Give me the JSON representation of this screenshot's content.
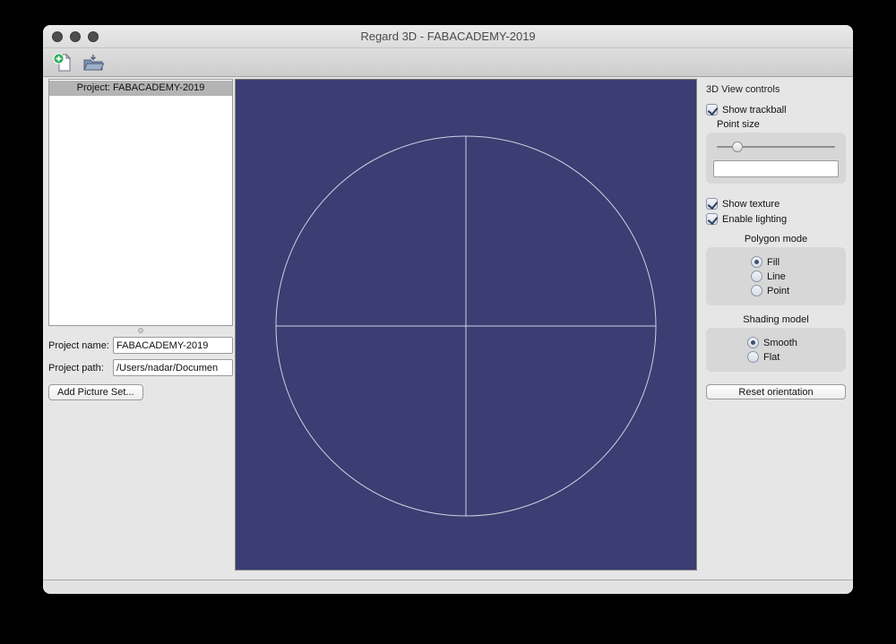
{
  "window": {
    "title": "Regard 3D - FABACADEMY-2019"
  },
  "toolbar": {
    "new_project_icon": "new-project",
    "open_project_icon": "open-project"
  },
  "left_panel": {
    "tree_selected": "Project: FABACADEMY-2019",
    "form": {
      "name_label": "Project name:",
      "name_value": "FABACADEMY-2019",
      "path_label": "Project path:",
      "path_value": "/Users/nadar/Documen",
      "add_button": "Add Picture Set..."
    }
  },
  "viewport": {
    "background": "#3b3d73",
    "trackball_color": "#e9e9f2"
  },
  "right_panel": {
    "title": "3D View controls",
    "checkboxes": [
      {
        "label": "Show trackball",
        "checked": true
      },
      {
        "label": "Show texture",
        "checked": true
      },
      {
        "label": "Enable lighting",
        "checked": true
      }
    ],
    "point_size": {
      "label": "Point size",
      "value": ""
    },
    "polygon_mode": {
      "label": "Polygon mode",
      "options": [
        {
          "label": "Fill",
          "selected": true
        },
        {
          "label": "Line",
          "selected": false
        },
        {
          "label": "Point",
          "selected": false
        }
      ]
    },
    "shading_model": {
      "label": "Shading model",
      "options": [
        {
          "label": "Smooth",
          "selected": true
        },
        {
          "label": "Flat",
          "selected": false
        }
      ]
    },
    "reset_button": "Reset orientation"
  }
}
